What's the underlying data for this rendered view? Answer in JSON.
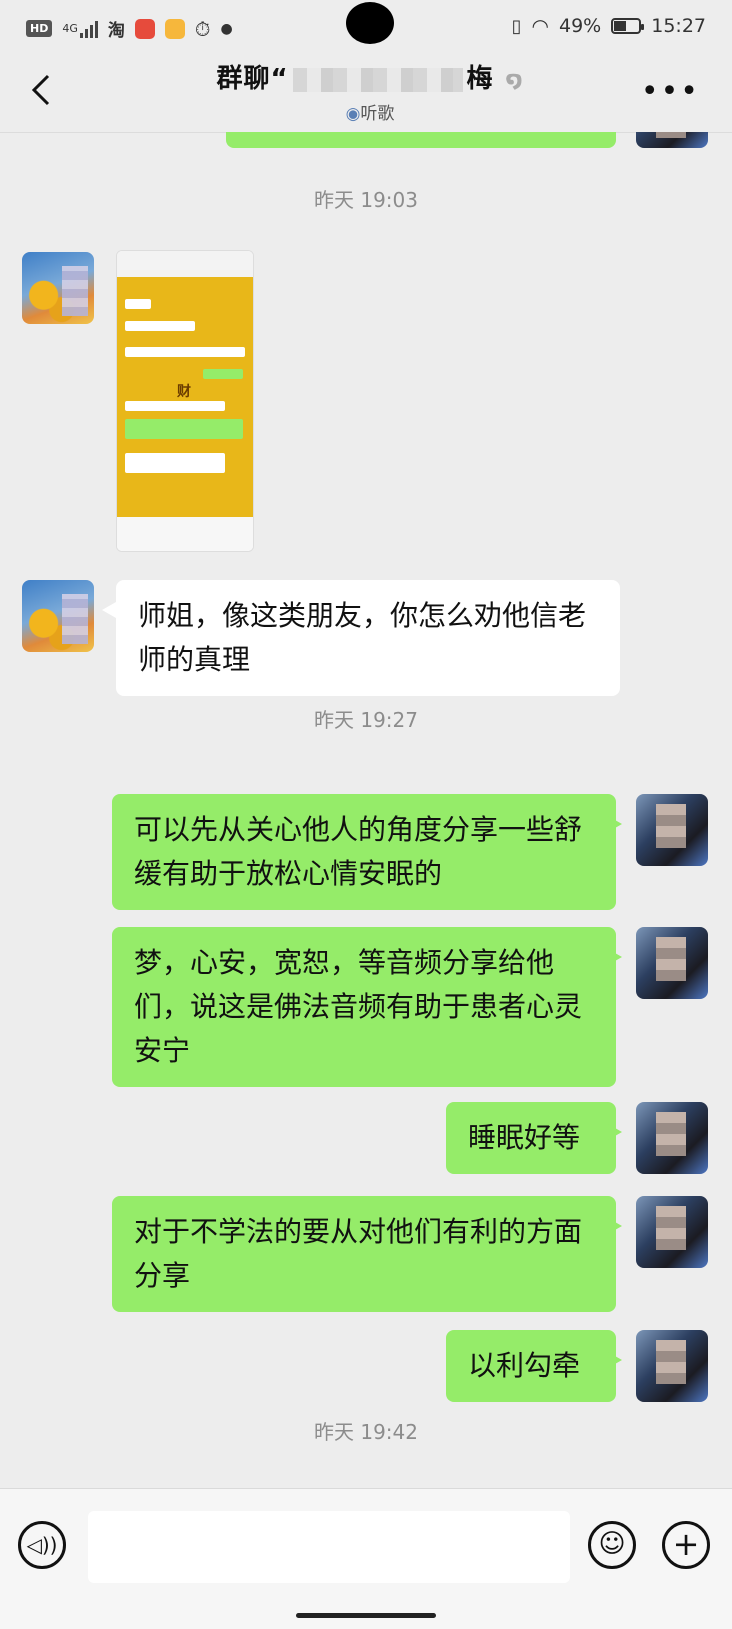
{
  "status_bar": {
    "hd": "HD",
    "network": "4G",
    "battery": "49%",
    "battery_level": 0.49,
    "time": "15:27"
  },
  "header": {
    "title_prefix": "群聊“",
    "title_suffix": "梅",
    "subtitle": "听歌"
  },
  "chat": {
    "time_1": "昨天 19:03",
    "time_2": "昨天 19:27",
    "time_3": "昨天 19:42",
    "msg_in_1": "师姐，像这类朋友，你怎么劝他信老师的真理",
    "msg_out_1": "可以先从关心他人的角度分享一些舒缓有助于放松心情安眠的",
    "msg_out_2": "梦，心安，宽恕，等音频分享给他们，说这是佛法音频有助于患者心灵安宁",
    "msg_out_3": "睡眠好等",
    "msg_out_4": "对于不学法的要从对他们有利的方面分享",
    "msg_out_5": "以利勾牵",
    "thumb_char": "财"
  },
  "colors": {
    "bubble_out": "#95ec69",
    "bubble_in": "#ffffff",
    "background": "#ededed"
  }
}
